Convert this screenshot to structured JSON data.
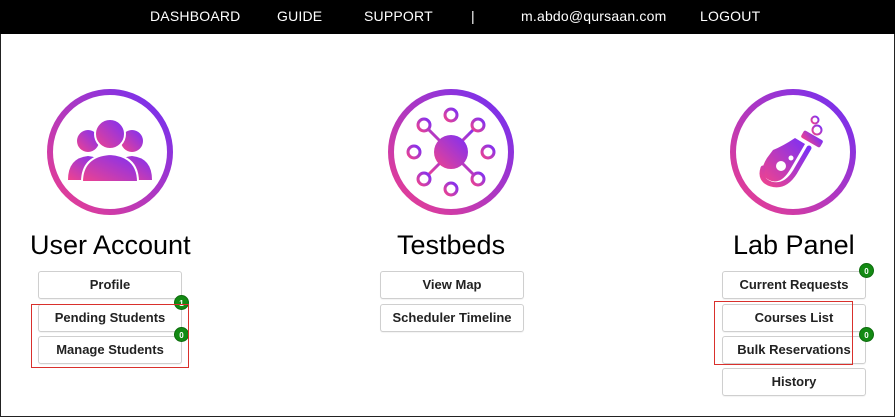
{
  "nav": {
    "dashboard": "DASHBOARD",
    "guide": "GUIDE",
    "support": "SUPPORT",
    "separator": "|",
    "user_email": "m.abdo@qursaan.com",
    "logout": "LOGOUT"
  },
  "colors": {
    "nav_bg": "#000000",
    "gradient_start": "#e84393",
    "gradient_end": "#7a2ff7",
    "badge_green": "#138a13",
    "highlight_red": "#d9302c"
  },
  "sections": {
    "user_account": {
      "title": "User Account",
      "icon": "users-icon",
      "buttons": {
        "profile": "Profile",
        "pending_students": "Pending Students",
        "manage_students": "Manage Students"
      },
      "badges": {
        "pending_students": "1",
        "manage_students": "0"
      }
    },
    "testbeds": {
      "title": "Testbeds",
      "icon": "network-hub-icon",
      "buttons": {
        "view_map": "View Map",
        "scheduler_timeline": "Scheduler Timeline"
      }
    },
    "lab_panel": {
      "title": "Lab Panel",
      "icon": "flask-icon",
      "buttons": {
        "current_requests": "Current Requests",
        "courses_list": "Courses List",
        "bulk_reservations": "Bulk Reservations",
        "history": "History"
      },
      "badges": {
        "current_requests": "0",
        "bulk_reservations": "0"
      }
    }
  }
}
